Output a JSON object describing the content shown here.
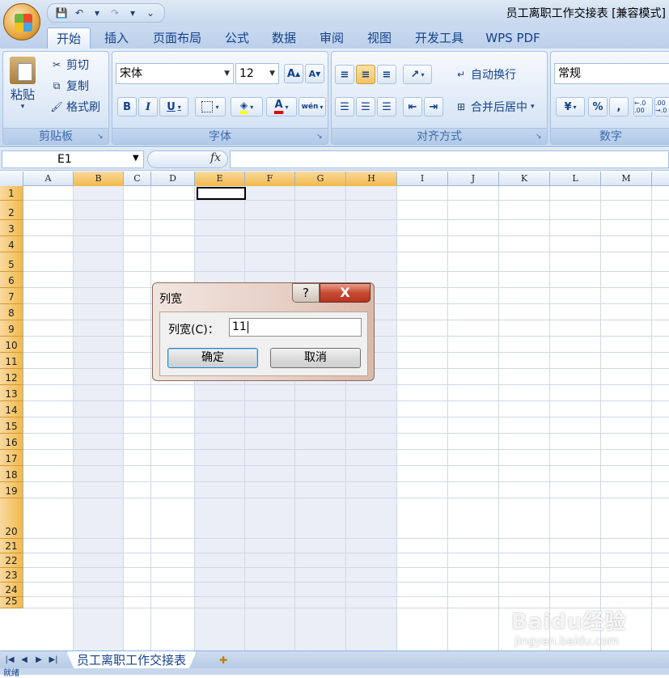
{
  "app": {
    "document_title": "员工离职工作交接表  [兼容模式]"
  },
  "quick_access": {
    "icons": [
      "save-icon",
      "undo-icon",
      "redo-icon",
      "customize-icon"
    ]
  },
  "tabs": [
    {
      "label": "开始",
      "active": true
    },
    {
      "label": "插入"
    },
    {
      "label": "页面布局"
    },
    {
      "label": "公式"
    },
    {
      "label": "数据"
    },
    {
      "label": "审阅"
    },
    {
      "label": "视图"
    },
    {
      "label": "开发工具"
    },
    {
      "label": "WPS PDF"
    }
  ],
  "ribbon": {
    "clipboard": {
      "label": "剪贴板",
      "paste": "粘贴",
      "cut": "剪切",
      "copy": "复制",
      "format_painter": "格式刷"
    },
    "font": {
      "label": "字体",
      "font_name": "宋体",
      "font_size": "12",
      "bold": "B",
      "italic": "I",
      "underline": "U",
      "grow": "A",
      "shrink": "A",
      "font_color_letter": "A",
      "phonetic": "wén"
    },
    "alignment": {
      "label": "对齐方式",
      "wrap_text": "自动换行",
      "merge_center": "合并后居中"
    },
    "number": {
      "label": "数字",
      "format": "常规",
      "percent": "%",
      "comma": ",",
      "inc_decimal": "←.0 .00",
      "dec_decimal": ".00 →.0"
    }
  },
  "formula_bar": {
    "name_box": "E1",
    "fx": "fx",
    "content": ""
  },
  "grid": {
    "columns": [
      "A",
      "B",
      "C",
      "D",
      "E",
      "F",
      "G",
      "H",
      "I",
      "J",
      "K",
      "L",
      "M"
    ],
    "selected_columns": [
      "B",
      "E",
      "F",
      "G",
      "H"
    ],
    "rows": [
      "1",
      "2",
      "3",
      "4",
      "5",
      "6",
      "7",
      "8",
      "9",
      "10",
      "11",
      "12",
      "13",
      "14",
      "15",
      "16",
      "17",
      "18",
      "19",
      "20",
      "21",
      "22",
      "23",
      "24",
      "25"
    ],
    "active_cell": "E1"
  },
  "sheets": {
    "nav_icons": [
      "first-sheet-icon",
      "prev-sheet-icon",
      "next-sheet-icon",
      "last-sheet-icon"
    ],
    "tabs": [
      "员工离职工作交接表"
    ]
  },
  "status": {
    "text": "就绪"
  },
  "dialog": {
    "title": "列宽",
    "help": "?",
    "close": "X",
    "label": "列宽(C)：",
    "value": "11",
    "ok": "确定",
    "cancel": "取消"
  },
  "watermark": {
    "main": "Baidu经验",
    "sub": "jingyan.baidu.com"
  },
  "colors": {
    "ribbon_text": "#15428b",
    "selection_orange": "#f2b94b",
    "close_red": "#c74a34"
  }
}
